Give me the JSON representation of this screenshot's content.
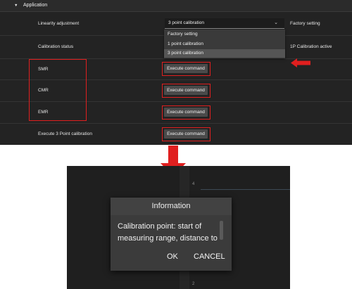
{
  "section": {
    "title": "Application",
    "caret_icon": "caret-down-icon"
  },
  "rows": {
    "linearity": {
      "label": "Linearity adjustment",
      "selected": "3 point calibration",
      "factory_label": "Factory setting",
      "options": [
        "Factory setting",
        "1 point calibration",
        "3 point calibration"
      ],
      "highlighted_option": "3 point calibration"
    },
    "calibration_status": {
      "label": "Calibration status",
      "value": "1P Calibration active"
    },
    "smr": {
      "label": "SMR",
      "button": "Execute command"
    },
    "cmr": {
      "label": "CMR",
      "button": "Execute command"
    },
    "emr": {
      "label": "EMR",
      "button": "Execute command"
    },
    "three_point": {
      "label": "Execute 3 Point calibration",
      "button": "Execute command"
    }
  },
  "dialog": {
    "title": "Information",
    "body": "Calibration point: start of measuring range, distance to",
    "ok": "OK",
    "cancel": "CANCEL"
  },
  "background_ticks": [
    "4",
    "2"
  ],
  "colors": {
    "panel_bg": "#232323",
    "annotation_red": "#e01f1f",
    "button_bg": "#4a4a4a",
    "dialog_bg": "#3b3b3b"
  }
}
